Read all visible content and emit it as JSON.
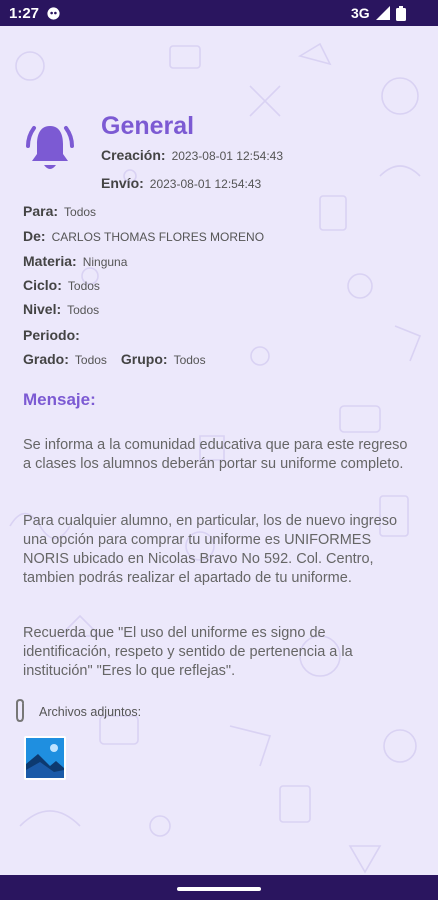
{
  "status_bar": {
    "time": "1:27",
    "network": "3G"
  },
  "notification": {
    "category": "General",
    "creacion_label": "Creación:",
    "creacion_value": "2023-08-01 12:54:43",
    "envio_label": "Envío:",
    "envio_value": "2023-08-01 12:54:43"
  },
  "fields": {
    "para_label": "Para:",
    "para_value": "Todos",
    "de_label": "De:",
    "de_value": "CARLOS THOMAS FLORES MORENO",
    "materia_label": "Materia:",
    "materia_value": "Ninguna",
    "ciclo_label": "Ciclo:",
    "ciclo_value": "Todos",
    "nivel_label": "Nivel:",
    "nivel_value": "Todos",
    "periodo_label": "Periodo:",
    "grado_label": "Grado:",
    "grado_value": "Todos",
    "grupo_label": "Grupo:",
    "grupo_value": "Todos"
  },
  "message": {
    "label": "Mensaje:",
    "p1": "Se informa a la comunidad educativa que para este regreso a clases los alumnos deberán portar su uniforme completo.",
    "p2": "Para cualquier alumno, en particular, los de nuevo ingreso una opción para comprar tu uniforme es UNIFORMES NORIS ubicado en Nicolas Bravo No 592. Col. Centro, tambien podrás realizar el apartado de tu uniforme.",
    "p3": "Recuerda que \"El uso del uniforme es signo de identificación, respeto y sentido de pertenencia a la institución\" \"Eres lo que reflejas\"."
  },
  "attachments": {
    "label": "Archivos adjuntos:"
  },
  "colors": {
    "accent": "#7c5ad3",
    "bar": "#2a155f",
    "background": "#ece8fb"
  },
  "icons": [
    "notification-icon",
    "signal-icon",
    "battery-icon",
    "bell-icon",
    "paperclip-icon",
    "image-thumbnail-icon"
  ]
}
